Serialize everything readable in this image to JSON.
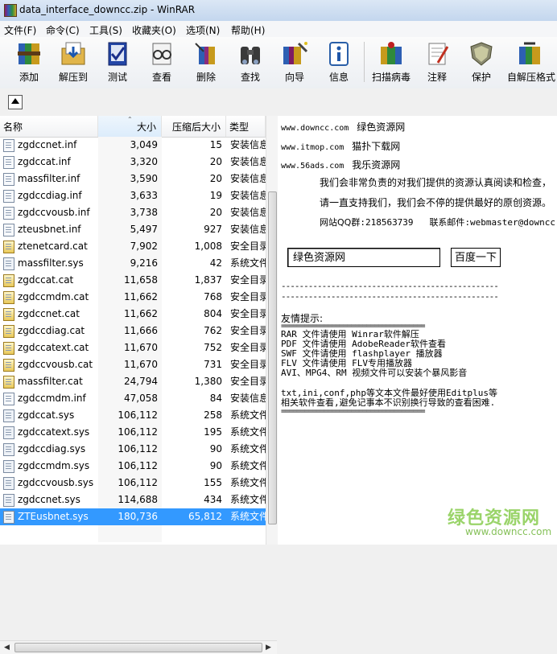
{
  "window": {
    "title": "data_interface_downcc.zip - WinRAR"
  },
  "menu": [
    "文件(F)",
    "命令(C)",
    "工具(S)",
    "收藏夹(O)",
    "选项(N)",
    "帮助(H)"
  ],
  "toolbar": [
    {
      "label": "添加",
      "icon": "add-archive-icon"
    },
    {
      "label": "解压到",
      "icon": "extract-to-icon"
    },
    {
      "label": "测试",
      "icon": "test-icon"
    },
    {
      "label": "查看",
      "icon": "view-icon"
    },
    {
      "label": "删除",
      "icon": "delete-icon"
    },
    {
      "label": "查找",
      "icon": "find-binoculars-icon"
    },
    {
      "label": "向导",
      "icon": "wizard-icon"
    },
    {
      "label": "信息",
      "icon": "info-icon"
    },
    {
      "label": "扫描病毒",
      "icon": "virus-scan-icon"
    },
    {
      "label": "注释",
      "icon": "comment-icon"
    },
    {
      "label": "保护",
      "icon": "protect-shield-icon"
    },
    {
      "label": "自解压格式",
      "icon": "sfx-icon"
    }
  ],
  "columns": {
    "name": "名称",
    "size": "大小",
    "packed": "压缩后大小",
    "type": "类型"
  },
  "files": [
    {
      "name": "zgdccnet.inf",
      "size": "3,049",
      "packed": "15",
      "type": "安装信息",
      "kind": "inf"
    },
    {
      "name": "zgdccat.inf",
      "size": "3,320",
      "packed": "20",
      "type": "安装信息",
      "kind": "inf"
    },
    {
      "name": "massfilter.inf",
      "size": "3,590",
      "packed": "20",
      "type": "安装信息",
      "kind": "inf"
    },
    {
      "name": "zgdccdiag.inf",
      "size": "3,633",
      "packed": "19",
      "type": "安装信息",
      "kind": "inf"
    },
    {
      "name": "zgdccvousb.inf",
      "size": "3,738",
      "packed": "20",
      "type": "安装信息",
      "kind": "inf"
    },
    {
      "name": "zteusbnet.inf",
      "size": "5,497",
      "packed": "927",
      "type": "安装信息",
      "kind": "inf"
    },
    {
      "name": "ztenetcard.cat",
      "size": "7,902",
      "packed": "1,008",
      "type": "安全目录",
      "kind": "cat"
    },
    {
      "name": "massfilter.sys",
      "size": "9,216",
      "packed": "42",
      "type": "系统文件",
      "kind": "sys"
    },
    {
      "name": "zgdccat.cat",
      "size": "11,658",
      "packed": "1,837",
      "type": "安全目录",
      "kind": "cat"
    },
    {
      "name": "zgdccmdm.cat",
      "size": "11,662",
      "packed": "768",
      "type": "安全目录",
      "kind": "cat"
    },
    {
      "name": "zgdccnet.cat",
      "size": "11,662",
      "packed": "804",
      "type": "安全目录",
      "kind": "cat"
    },
    {
      "name": "zgdccdiag.cat",
      "size": "11,666",
      "packed": "762",
      "type": "安全目录",
      "kind": "cat"
    },
    {
      "name": "zgdccatext.cat",
      "size": "11,670",
      "packed": "752",
      "type": "安全目录",
      "kind": "cat"
    },
    {
      "name": "zgdccvousb.cat",
      "size": "11,670",
      "packed": "731",
      "type": "安全目录",
      "kind": "cat"
    },
    {
      "name": "massfilter.cat",
      "size": "24,794",
      "packed": "1,380",
      "type": "安全目录",
      "kind": "cat"
    },
    {
      "name": "zgdccmdm.inf",
      "size": "47,058",
      "packed": "84",
      "type": "安装信息",
      "kind": "inf"
    },
    {
      "name": "zgdccat.sys",
      "size": "106,112",
      "packed": "258",
      "type": "系统文件",
      "kind": "sys"
    },
    {
      "name": "zgdccatext.sys",
      "size": "106,112",
      "packed": "195",
      "type": "系统文件",
      "kind": "sys"
    },
    {
      "name": "zgdccdiag.sys",
      "size": "106,112",
      "packed": "90",
      "type": "系统文件",
      "kind": "sys"
    },
    {
      "name": "zgdccmdm.sys",
      "size": "106,112",
      "packed": "90",
      "type": "系统文件",
      "kind": "sys"
    },
    {
      "name": "zgdccvousb.sys",
      "size": "106,112",
      "packed": "155",
      "type": "系统文件",
      "kind": "sys"
    },
    {
      "name": "zgdccnet.sys",
      "size": "114,688",
      "packed": "434",
      "type": "系统文件",
      "kind": "sys"
    },
    {
      "name": "ZTEusbnet.sys",
      "size": "180,736",
      "packed": "65,812",
      "type": "系统文件",
      "kind": "sys",
      "selected": true
    }
  ],
  "comment": {
    "sites": [
      {
        "url": "www.downcc.com",
        "name": "绿色资源网"
      },
      {
        "url": "www.itmop.com",
        "name": "猫扑下载网"
      },
      {
        "url": "www.56ads.com",
        "name": "我乐资源网"
      }
    ],
    "para1": "我们会非常负责的对我们提供的资源认真阅读和检查，",
    "para2": "请一直支持我们，我们会不停的提供最好的原创资源。",
    "qq_label": "网站QQ群",
    "qq_value": ":218563739",
    "mail_label": "联系邮件",
    "mail_value": ":webmaster@downcc.com",
    "input_text": "绿色资源网",
    "button_text": "百度一下",
    "dashes": "------------------------------------------------",
    "friend_title": "友情提示:",
    "equals": "=====================================",
    "tips": [
      "RAR 文件请使用 Winrar软件解压",
      "PDF 文件请使用 AdobeReader软件查看",
      "SWF 文件请使用 flashplayer 播放器",
      "FLV 文件请使用 FLV专用播放器",
      "AVI、MPG4、RM 视频文件可以安装个暴风影音"
    ],
    "tip_txt1": "txt,ini,conf,php等文本文件最好使用Editplus等",
    "tip_txt2": "相关软件查看,避免记事本不识别换行导致的查看困难."
  },
  "watermark": {
    "line1": "绿色资源网",
    "line2": "www.downcc.com"
  }
}
